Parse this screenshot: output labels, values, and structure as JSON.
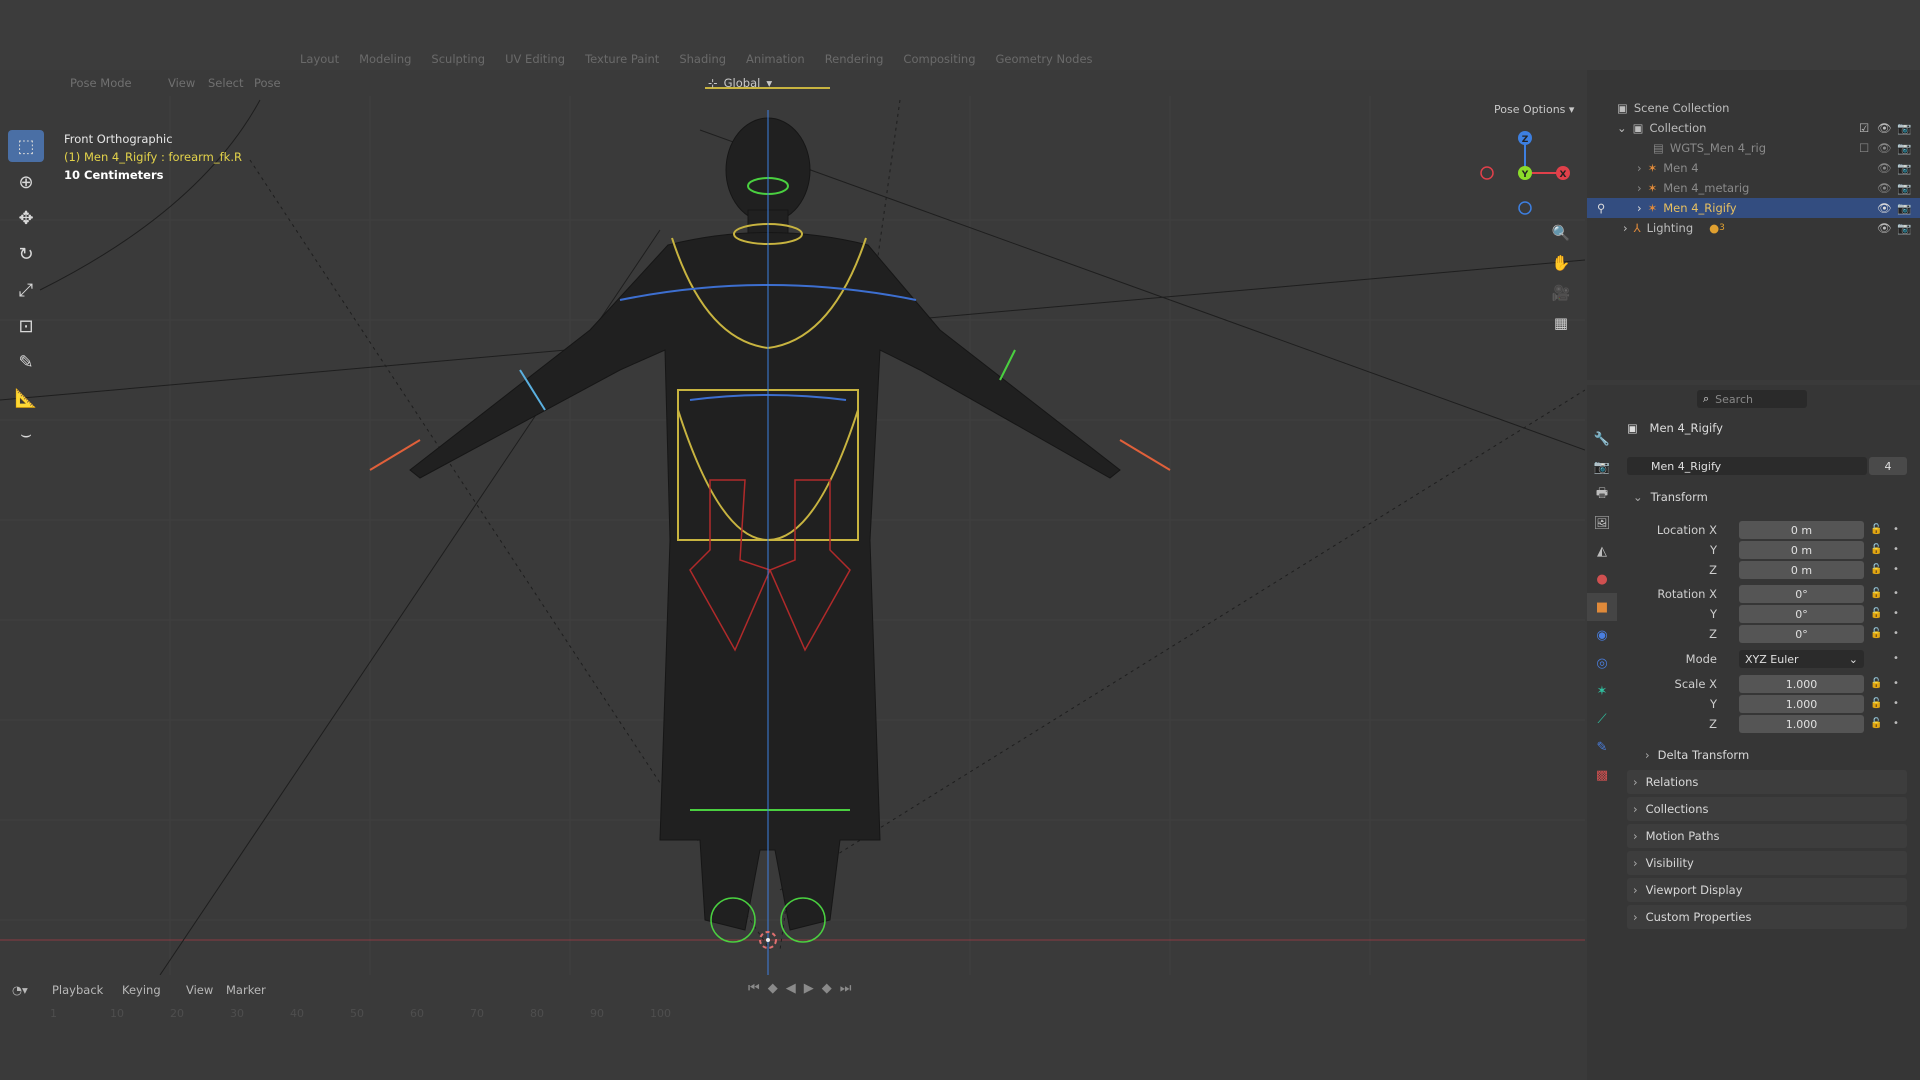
{
  "workspaces": [
    "Layout",
    "Modeling",
    "Sculpting",
    "UV Editing",
    "Texture Paint",
    "Shading",
    "Animation",
    "Rendering",
    "Compositing",
    "Geometry Nodes"
  ],
  "viewport_header": {
    "mode": "Pose Mode",
    "menus": [
      "View",
      "Select",
      "Pose"
    ],
    "orientation": "Global",
    "pose_options": "Pose Options"
  },
  "viewport_info": {
    "view_name": "Front Orthographic",
    "active_object": "(1) Men 4_Rigify : forearm_fk.R",
    "grid_scale": "10 Centimeters"
  },
  "gizmo": {
    "x_label": "X",
    "y_label": "Y",
    "z_label": "Z",
    "x_color": "#e0404a",
    "y_color": "#8bdc2a",
    "z_color": "#3d7fe0"
  },
  "timeline": {
    "menus": [
      "Playback",
      "Keying",
      "View",
      "Marker"
    ],
    "frame_marks": [
      "1",
      "10",
      "20",
      "30",
      "40",
      "50",
      "60",
      "70",
      "80",
      "90",
      "100"
    ]
  },
  "outliner": {
    "root": "Scene Collection",
    "items": [
      {
        "label": "Collection",
        "depth": 1
      },
      {
        "label": "WGTS_Men 4_rig",
        "depth": 2
      },
      {
        "label": "Men 4",
        "depth": 2
      },
      {
        "label": "Men 4_metarig",
        "depth": 2
      },
      {
        "label": "Men 4_Rigify",
        "depth": 2
      },
      {
        "label": "Lighting",
        "depth": 1
      }
    ],
    "lighting_count": "3"
  },
  "properties": {
    "search_placeholder": "Search",
    "object_name": "Men 4_Rigify",
    "datablock_name": "Men 4_Rigify",
    "user_count": "4",
    "transform_label": "Transform",
    "location_label": "Location X",
    "location": [
      "0 m",
      "0 m",
      "0 m"
    ],
    "rotation_label": "Rotation X",
    "rotation": [
      "0°",
      "0°",
      "0°"
    ],
    "mode_label": "Mode",
    "mode_value": "XYZ Euler",
    "scale_label": "Scale X",
    "scale": [
      "1.000",
      "1.000",
      "1.000"
    ],
    "axis_y": "Y",
    "axis_z": "Z",
    "sections": [
      "Delta Transform",
      "Relations",
      "Collections",
      "Motion Paths",
      "Visibility",
      "Viewport Display",
      "Custom Properties"
    ]
  }
}
